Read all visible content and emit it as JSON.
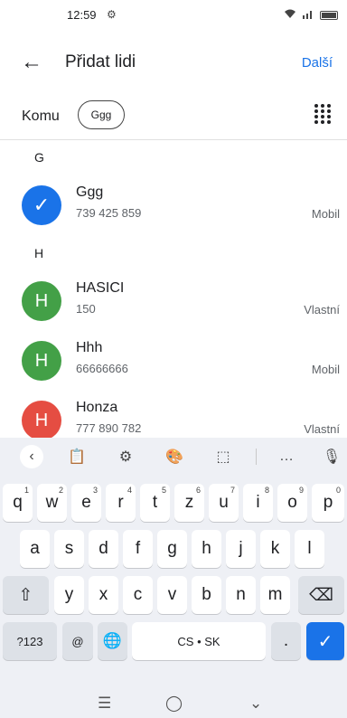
{
  "status": {
    "time": "12:59",
    "gear": "⚙",
    "wifi": "wifi-icon",
    "signal": "signal-icon"
  },
  "header": {
    "back_icon": "←",
    "title": "Přidat lidi",
    "next_label": "Další"
  },
  "recipients": {
    "to_label": "Komu",
    "chip_label": "Ggg"
  },
  "sections": [
    {
      "letter": "G"
    },
    {
      "letter": "H"
    }
  ],
  "contacts": [
    {
      "avatar": "✓",
      "name": "Ggg",
      "number": "739 425 859",
      "type": "Mobil"
    },
    {
      "avatar": "H",
      "name": "HASICI",
      "number": "150",
      "type": "Vlastní"
    },
    {
      "avatar": "H",
      "name": "Hhh",
      "number": "66666666",
      "type": "Mobil"
    },
    {
      "avatar": "H",
      "name": "Honza",
      "number": "777 890 782",
      "type": "Vlastní"
    }
  ],
  "keyboard": {
    "toolbar": [
      "‹",
      "📋",
      "⚙",
      "🎨",
      "⬚",
      "…",
      "🎙"
    ],
    "row1": [
      {
        "key": "q",
        "hint": "1"
      },
      {
        "key": "w",
        "hint": "2"
      },
      {
        "key": "e",
        "hint": "3"
      },
      {
        "key": "r",
        "hint": "4"
      },
      {
        "key": "t",
        "hint": "5"
      },
      {
        "key": "z",
        "hint": "6"
      },
      {
        "key": "u",
        "hint": "7"
      },
      {
        "key": "i",
        "hint": "8"
      },
      {
        "key": "o",
        "hint": "9"
      },
      {
        "key": "p",
        "hint": "0"
      }
    ],
    "row2": [
      "a",
      "s",
      "d",
      "f",
      "g",
      "h",
      "j",
      "k",
      "l"
    ],
    "row3": [
      "y",
      "x",
      "c",
      "v",
      "b",
      "n",
      "m"
    ],
    "shift": "⇧",
    "backspace": "⌫",
    "symbols": "?123",
    "at": "@",
    "globe": "🌐",
    "space": "CS • SK",
    "period": ".",
    "enter": "✓"
  },
  "nav": {
    "recent": "☰",
    "home": "◯",
    "back": "⌄"
  },
  "colors": {
    "accent": "#1a73e8",
    "avatar_green": "#43a047",
    "avatar_red": "#e54d42",
    "keyboard_bg": "#eef0f5"
  }
}
